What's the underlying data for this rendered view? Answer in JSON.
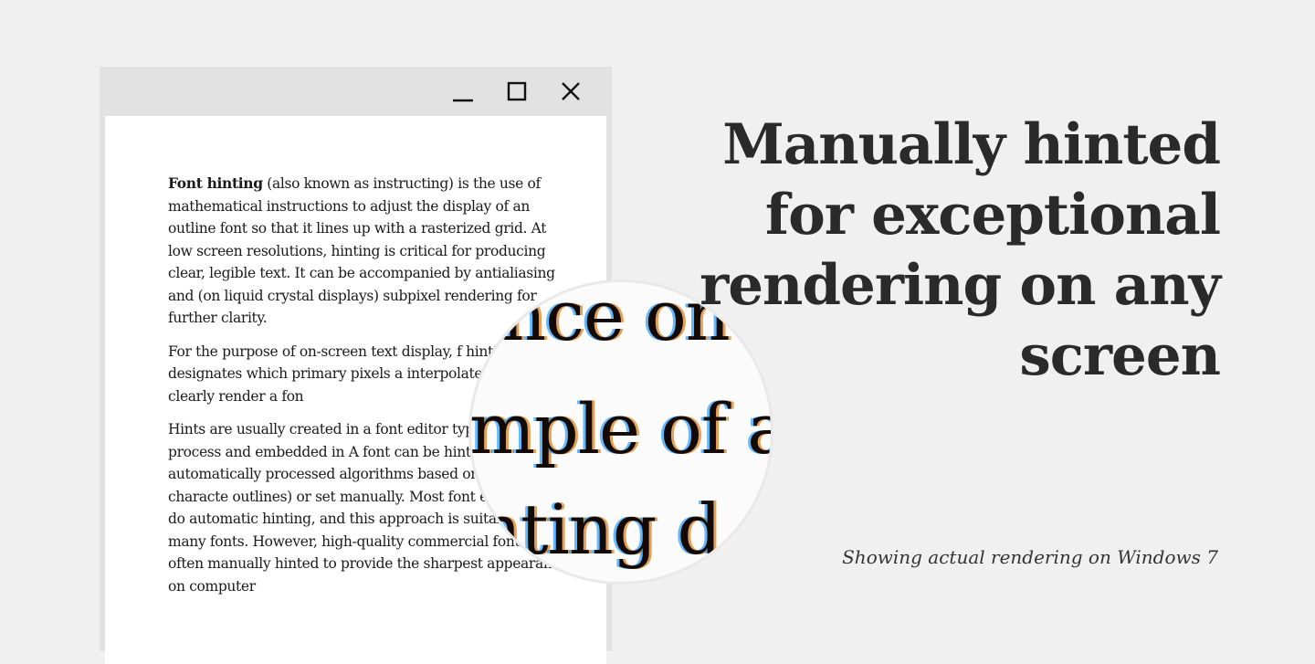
{
  "window": {
    "controls": {
      "minimize_icon": "minimize-icon",
      "maximize_icon": "maximize-icon",
      "close_icon": "close-icon"
    },
    "paragraphs": [
      {
        "bold": "Font hinting",
        "text": " (also known as instructing) is the use of mathematical instructions to adjust the display of an outline font so that it lines up with a rasterized grid. At low screen resolutions, hinting is critical for producing clear, legible text. It can be accompanied by antialiasing and (on liquid crystal displays) subpixel rendering for further clarity."
      },
      {
        "text": "For the purpose of on-screen text display, f hinting designates which primary pixels a interpolated to more clearly render a fon"
      },
      {
        "text": "Hints are usually created in a font editor typeface design process and embedded in A font can be hinted either automatically processed algorithms based on the characte outlines) or set manually. Most font editors ar to do automatic hinting, and this approach is suitable for many fonts. However, high-quality commercial fonts are often manually hinted to provide the sharpest appearance on computer"
      }
    ]
  },
  "magnifier": {
    "lines": [
      "ince on",
      "mple of a",
      "nting d"
    ]
  },
  "headline": "Manually hinted for exceptional rendering on any screen",
  "caption": "Showing actual rendering on Windows 7",
  "colors": {
    "background": "#f0f0f0",
    "window_frame": "#e2e2e2",
    "text": "#1a1a1a",
    "headline": "#2a2a2a"
  }
}
